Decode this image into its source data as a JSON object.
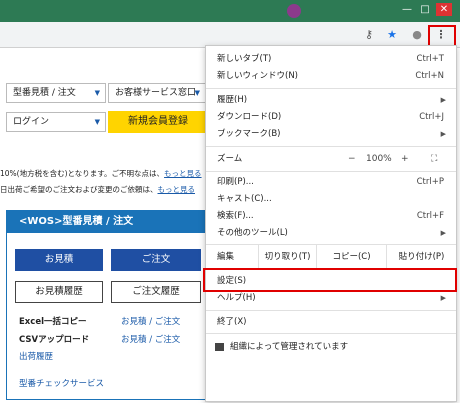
{
  "toolbar": {
    "icons": [
      "key-icon",
      "star-icon",
      "avatar-icon",
      "more-vert-icon"
    ],
    "key_glyph": "⚷",
    "star_glyph": "★",
    "avatar_glyph": "●",
    "kebab_glyph": "⋮"
  },
  "window_controls": {
    "minimize": "—",
    "maximize": "□",
    "close": "✕"
  },
  "page": {
    "dropdown_quote_order": "型番見積 / 注文",
    "dropdown_customer_service": "お客様サービス窓口",
    "dropdown_login": "ログイン",
    "caret": "▼",
    "register_button": "新規会員登録",
    "notice_1": "10%(地方税を含む)となります。ご不明な点は、",
    "notice_1_link": "もっと見る",
    "notice_2": "日出荷ご希望のご注文および変更のご依頼は、",
    "notice_2_link": "もっと見る",
    "wos": {
      "header": "<WOS>型番見積 / 注文",
      "btn_quote": "お見積",
      "btn_order": "ご注文",
      "btn_quote_history": "お見積履歴",
      "btn_order_history": "ご注文履歴",
      "excel_copy": "Excel一括コピー",
      "excel_copy_link": "お見積 / ご注文",
      "csv_upload": "CSVアップロード",
      "csv_upload_link": "お見積 / ご注文",
      "shipping_history": "出荷履歴",
      "model_check": "型番チェックサービス"
    }
  },
  "menu": {
    "new_tab": {
      "label": "新しいタブ(T)",
      "shortcut": "Ctrl+T"
    },
    "new_window": {
      "label": "新しいウィンドウ(N)",
      "shortcut": "Ctrl+N"
    },
    "history": {
      "label": "履歴(H)"
    },
    "downloads": {
      "label": "ダウンロード(D)",
      "shortcut": "Ctrl+J"
    },
    "bookmarks": {
      "label": "ブックマーク(B)"
    },
    "zoom": {
      "label": "ズーム",
      "minus": "−",
      "value": "100%",
      "plus": "+",
      "fullscreen": "⛶"
    },
    "print": {
      "label": "印刷(P)...",
      "shortcut": "Ctrl+P"
    },
    "cast": {
      "label": "キャスト(C)..."
    },
    "find": {
      "label": "検索(F)...",
      "shortcut": "Ctrl+F"
    },
    "more_tools": {
      "label": "その他のツール(L)"
    },
    "edit": {
      "label": "編集",
      "cut": "切り取り(T)",
      "copy": "コピー(C)",
      "paste": "貼り付け(P)"
    },
    "settings": {
      "label": "設定(S)"
    },
    "help": {
      "label": "ヘルプ(H)"
    },
    "exit": {
      "label": "終了(X)"
    },
    "managed": {
      "label": "組織によって管理されています"
    },
    "submenu_arrow": "▶"
  },
  "highlight_color": "#e00000"
}
